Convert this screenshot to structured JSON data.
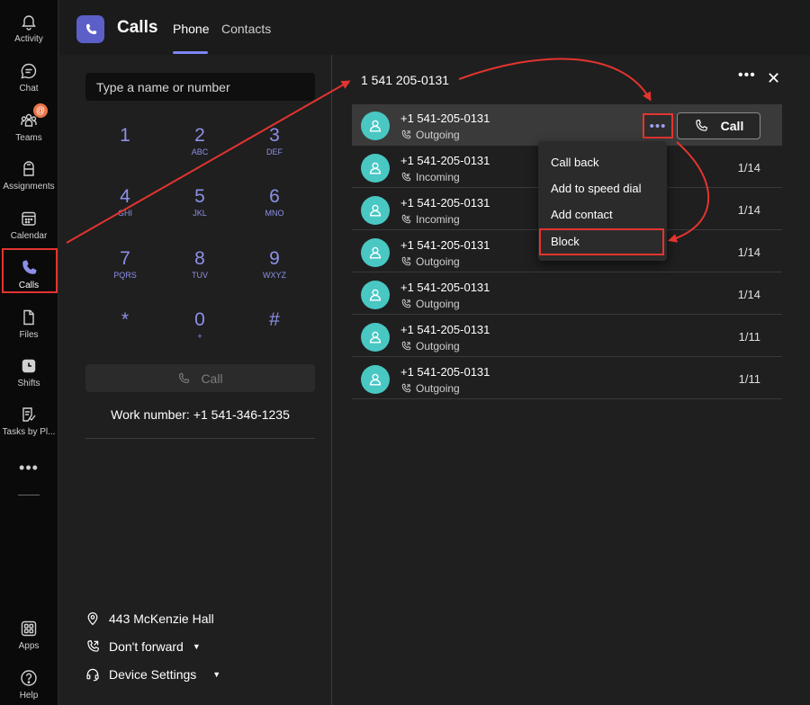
{
  "rail": {
    "items": [
      {
        "label": "Activity",
        "icon": "bell-icon"
      },
      {
        "label": "Chat",
        "icon": "chat-icon"
      },
      {
        "label": "Teams",
        "icon": "teams-icon",
        "badge": "@"
      },
      {
        "label": "Assignments",
        "icon": "assignments-icon"
      },
      {
        "label": "Calendar",
        "icon": "calendar-icon"
      },
      {
        "label": "Calls",
        "icon": "phone-icon",
        "active": true
      },
      {
        "label": "Files",
        "icon": "file-icon"
      },
      {
        "label": "Shifts",
        "icon": "clock-icon"
      },
      {
        "label": "Tasks by Pl...",
        "icon": "tasks-icon"
      },
      {
        "label": "Apps",
        "icon": "apps-icon"
      },
      {
        "label": "Help",
        "icon": "help-icon"
      }
    ],
    "more_label": "•••"
  },
  "header": {
    "title": "Calls",
    "tabs": [
      {
        "label": "Phone",
        "active": true
      },
      {
        "label": "Contacts",
        "active": false
      }
    ]
  },
  "dialpad": {
    "search_placeholder": "Type a name or number",
    "keys": [
      {
        "digit": "1",
        "letters": ""
      },
      {
        "digit": "2",
        "letters": "ABC"
      },
      {
        "digit": "3",
        "letters": "DEF"
      },
      {
        "digit": "4",
        "letters": "GHI"
      },
      {
        "digit": "5",
        "letters": "JKL"
      },
      {
        "digit": "6",
        "letters": "MNO"
      },
      {
        "digit": "7",
        "letters": "PQRS"
      },
      {
        "digit": "8",
        "letters": "TUV"
      },
      {
        "digit": "9",
        "letters": "WXYZ"
      },
      {
        "digit": "*",
        "letters": ""
      },
      {
        "digit": "0",
        "letters": "+"
      },
      {
        "digit": "#",
        "letters": ""
      }
    ],
    "call_label": "Call",
    "work_number_label": "Work number:",
    "work_number_value": "+1 541-346-1235",
    "location": "443 McKenzie Hall",
    "forwarding": "Don't forward",
    "device_settings": "Device Settings"
  },
  "detail": {
    "title": "1 541 205-0131",
    "more_label": "•••",
    "close_label": "✕",
    "call_button": "Call",
    "row_more_label": "•••",
    "history": [
      {
        "number": "+1 541-205-0131",
        "direction": "Outgoing",
        "date": ""
      },
      {
        "number": "+1 541-205-0131",
        "direction": "Incoming",
        "date": "1/14"
      },
      {
        "number": "+1 541-205-0131",
        "direction": "Incoming",
        "date": "1/14"
      },
      {
        "number": "+1 541-205-0131",
        "direction": "Outgoing",
        "date": "1/14"
      },
      {
        "number": "+1 541-205-0131",
        "direction": "Outgoing",
        "date": "1/14"
      },
      {
        "number": "+1 541-205-0131",
        "direction": "Outgoing",
        "date": "1/11"
      },
      {
        "number": "+1 541-205-0131",
        "direction": "Outgoing",
        "date": "1/11"
      }
    ]
  },
  "context_menu": {
    "items": [
      "Call back",
      "Add to speed dial",
      "Add contact",
      "Block"
    ]
  },
  "colors": {
    "accent": "#7f85f5",
    "dial_digit": "#8d90e8",
    "avatar": "#49c7c3",
    "annotation_red": "#e3342f",
    "badge": "#e97548"
  }
}
